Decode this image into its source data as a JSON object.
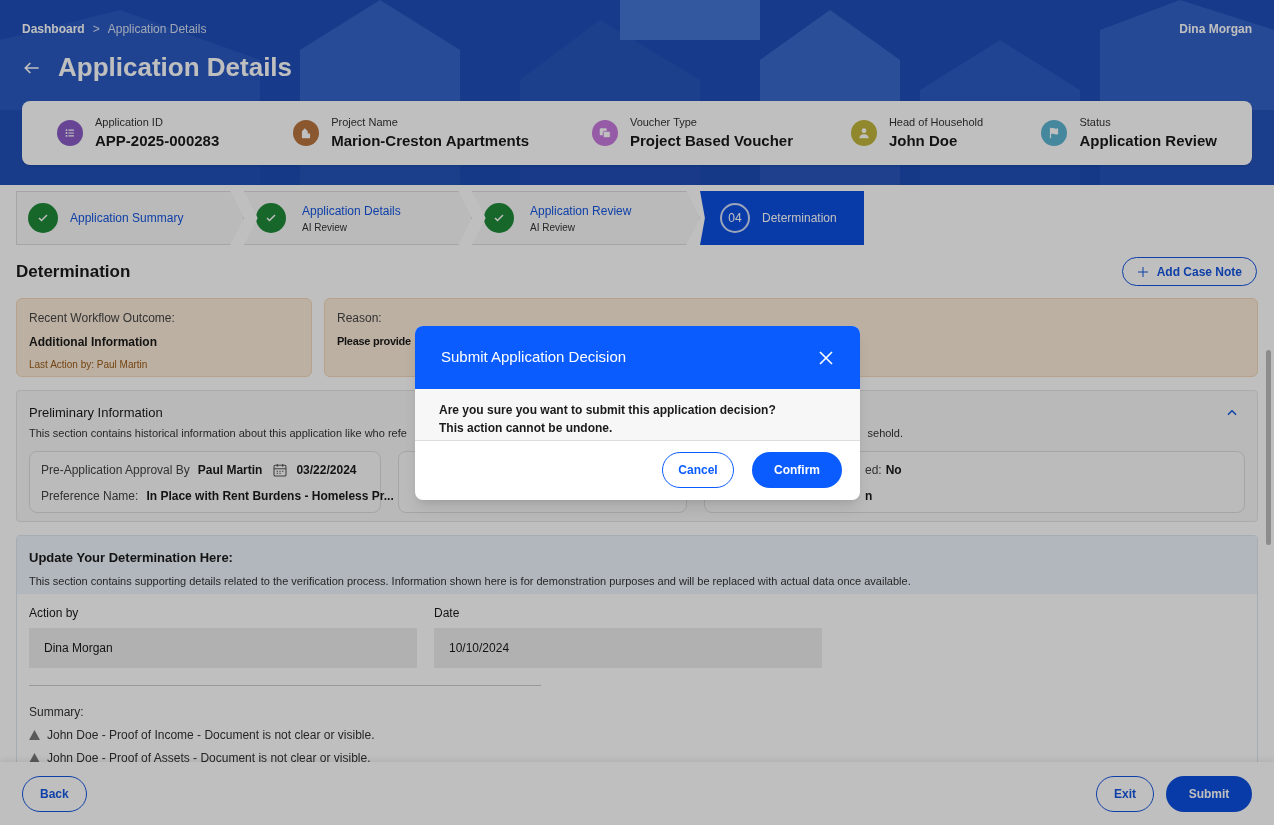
{
  "breadcrumb": [
    {
      "label": "Dashboard",
      "current": false
    },
    {
      "label": "Application Details",
      "current": true
    }
  ],
  "breadcrumb_separator": ">",
  "user": "Dina Morgan",
  "title": "Application Details",
  "summary": [
    {
      "kind": "list",
      "label": "Application ID",
      "value": "APP-2025-000283"
    },
    {
      "kind": "building",
      "label": "Project Name",
      "value": "Marion-Creston Apartments"
    },
    {
      "kind": "cards",
      "label": "Voucher Type",
      "value": "Project Based Voucher"
    },
    {
      "kind": "person",
      "label": "Head of Household",
      "value": "John Doe"
    },
    {
      "kind": "flag",
      "label": "Status",
      "value": "Application Review"
    }
  ],
  "steps": [
    {
      "kind": "done",
      "title": "Application Summary"
    },
    {
      "kind": "done",
      "title": "Application Details",
      "subtitle": "AI Review"
    },
    {
      "kind": "done",
      "title": "Application Review",
      "subtitle": "AI Review"
    },
    {
      "kind": "current",
      "number": "04",
      "title": "Determination"
    }
  ],
  "section_title": "Determination",
  "add_note_button": "Add Case Note",
  "outcome": {
    "label": "Recent Workflow Outcome:",
    "value": "Additional Information",
    "last_action": "Last Action by: Paul Martin"
  },
  "reason": {
    "label": "Reason:",
    "value": "Please provide"
  },
  "preliminary": {
    "title": "Preliminary Information",
    "expanded": true,
    "description_left": "This section contains historical information about this application like who refe",
    "description_right": "sehold.",
    "card_1": [
      {
        "label": "Pre-Application Approval By",
        "value": "Paul Martin",
        "date": "03/22/2024"
      },
      {
        "label": "Preference Name:",
        "value": "In Place with Rent Burdens - Homeless Pr..."
      }
    ],
    "card_3": [
      {
        "label": "ed:",
        "value": "No"
      },
      {
        "value": "n"
      }
    ]
  },
  "update": {
    "title": "Update Your Determination Here:",
    "description": "This section contains supporting details related to the verification process. Information shown here is for demonstration purposes and will be replaced with actual data once available.",
    "fields": [
      {
        "label": "Action by",
        "value": "Dina Morgan"
      },
      {
        "label": "Date",
        "value": "10/10/2024"
      }
    ],
    "summary_label": "Summary:",
    "summary_items": [
      "John Doe - Proof of Income - Document is not clear or visible.",
      "John Doe - Proof of Assets - Document is not clear or visible."
    ]
  },
  "footer": {
    "back": "Back",
    "exit": "Exit",
    "submit": "Submit"
  },
  "modal": {
    "title": "Submit Application Decision",
    "message": [
      "Are you sure you want to submit this application decision?",
      "This action cannot be undone."
    ],
    "cancel": "Cancel",
    "confirm": "Confirm"
  }
}
